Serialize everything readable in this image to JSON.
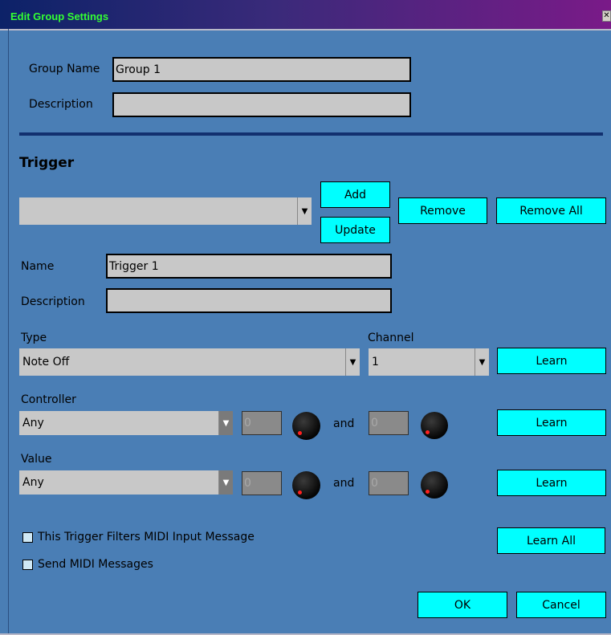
{
  "window": {
    "title": "Edit Group Settings",
    "close_glyph": "✕"
  },
  "group": {
    "name_label": "Group Name",
    "name_value": "Group 1",
    "desc_label": "Description",
    "desc_value": ""
  },
  "trigger": {
    "section_title": "Trigger",
    "selector_value": "",
    "add_label": "Add",
    "update_label": "Update",
    "remove_label": "Remove",
    "remove_all_label": "Remove All",
    "name_label": "Name",
    "name_value": "Trigger 1",
    "desc_label": "Description",
    "desc_value": "",
    "type_label": "Type",
    "type_value": "Note Off",
    "channel_label": "Channel",
    "channel_value": "1",
    "learn_label": "Learn",
    "controller_label": "Controller",
    "controller_value": "Any",
    "controller_min": "0",
    "controller_max": "0",
    "value_label": "Value",
    "value_value": "Any",
    "value_min": "0",
    "value_max": "0",
    "and_label": "and",
    "filter_checkbox_label": "This Trigger Filters MIDI Input Message",
    "send_checkbox_label": "Send MIDI Messages",
    "learn_all_label": "Learn All"
  },
  "footer": {
    "ok_label": "OK",
    "cancel_label": "Cancel"
  },
  "icons": {
    "dropdown_arrow": "chevron-down-icon",
    "knob": "knob-icon"
  },
  "colors": {
    "background": "#4a7eb5",
    "button": "#00ffff",
    "title_text": "#33ff33",
    "divider": "#12306f"
  }
}
